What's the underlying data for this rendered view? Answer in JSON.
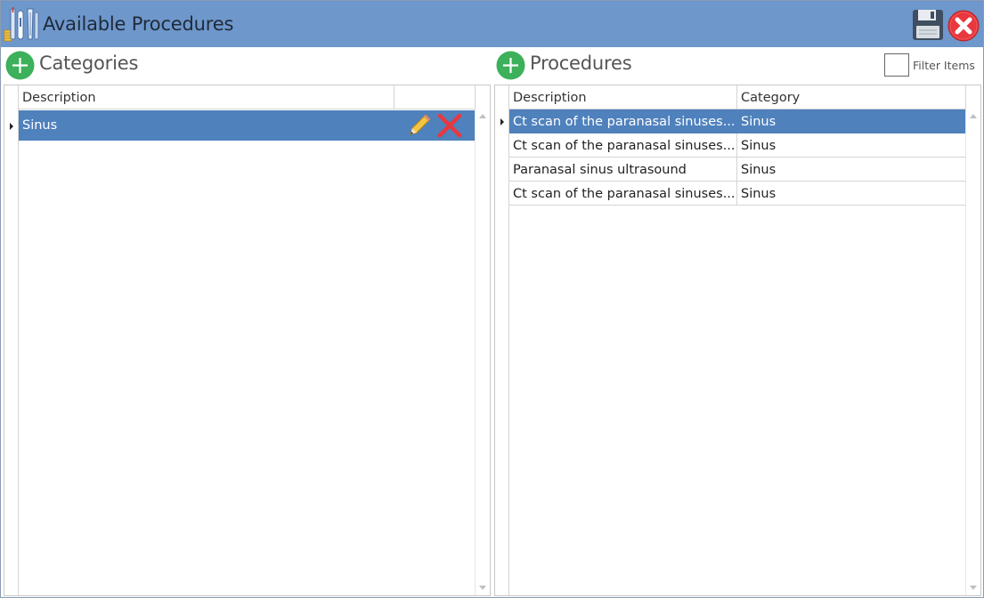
{
  "window": {
    "title": "Available Procedures"
  },
  "toolbar": {
    "save_icon": "floppy-disk-icon",
    "close_icon": "close-circle-icon"
  },
  "categories": {
    "title": "Categories",
    "add_icon": "plus-circle-icon",
    "columns": [
      "Description",
      ""
    ],
    "rows": [
      {
        "description": "Sinus",
        "selected": true
      }
    ],
    "row_actions": {
      "edit_icon": "pencil-icon",
      "delete_icon": "red-x-icon"
    }
  },
  "procedures": {
    "title": "Procedures",
    "add_icon": "plus-circle-icon",
    "filter_label": "Filter Items",
    "filter_checked": false,
    "columns": [
      "Description",
      "Category"
    ],
    "rows": [
      {
        "description": "Ct scan of the paranasal sinuses...",
        "category": "Sinus",
        "selected": true
      },
      {
        "description": "Ct scan of the paranasal sinuses...",
        "category": "Sinus",
        "selected": false
      },
      {
        "description": "Paranasal sinus ultrasound",
        "category": "Sinus",
        "selected": false
      },
      {
        "description": "Ct scan of the paranasal sinuses...",
        "category": "Sinus",
        "selected": false
      }
    ]
  },
  "colors": {
    "titlebar": "#6e97cb",
    "selection": "#4f81bd",
    "add_green": "#3cb05a",
    "close_red": "#e8383d"
  }
}
